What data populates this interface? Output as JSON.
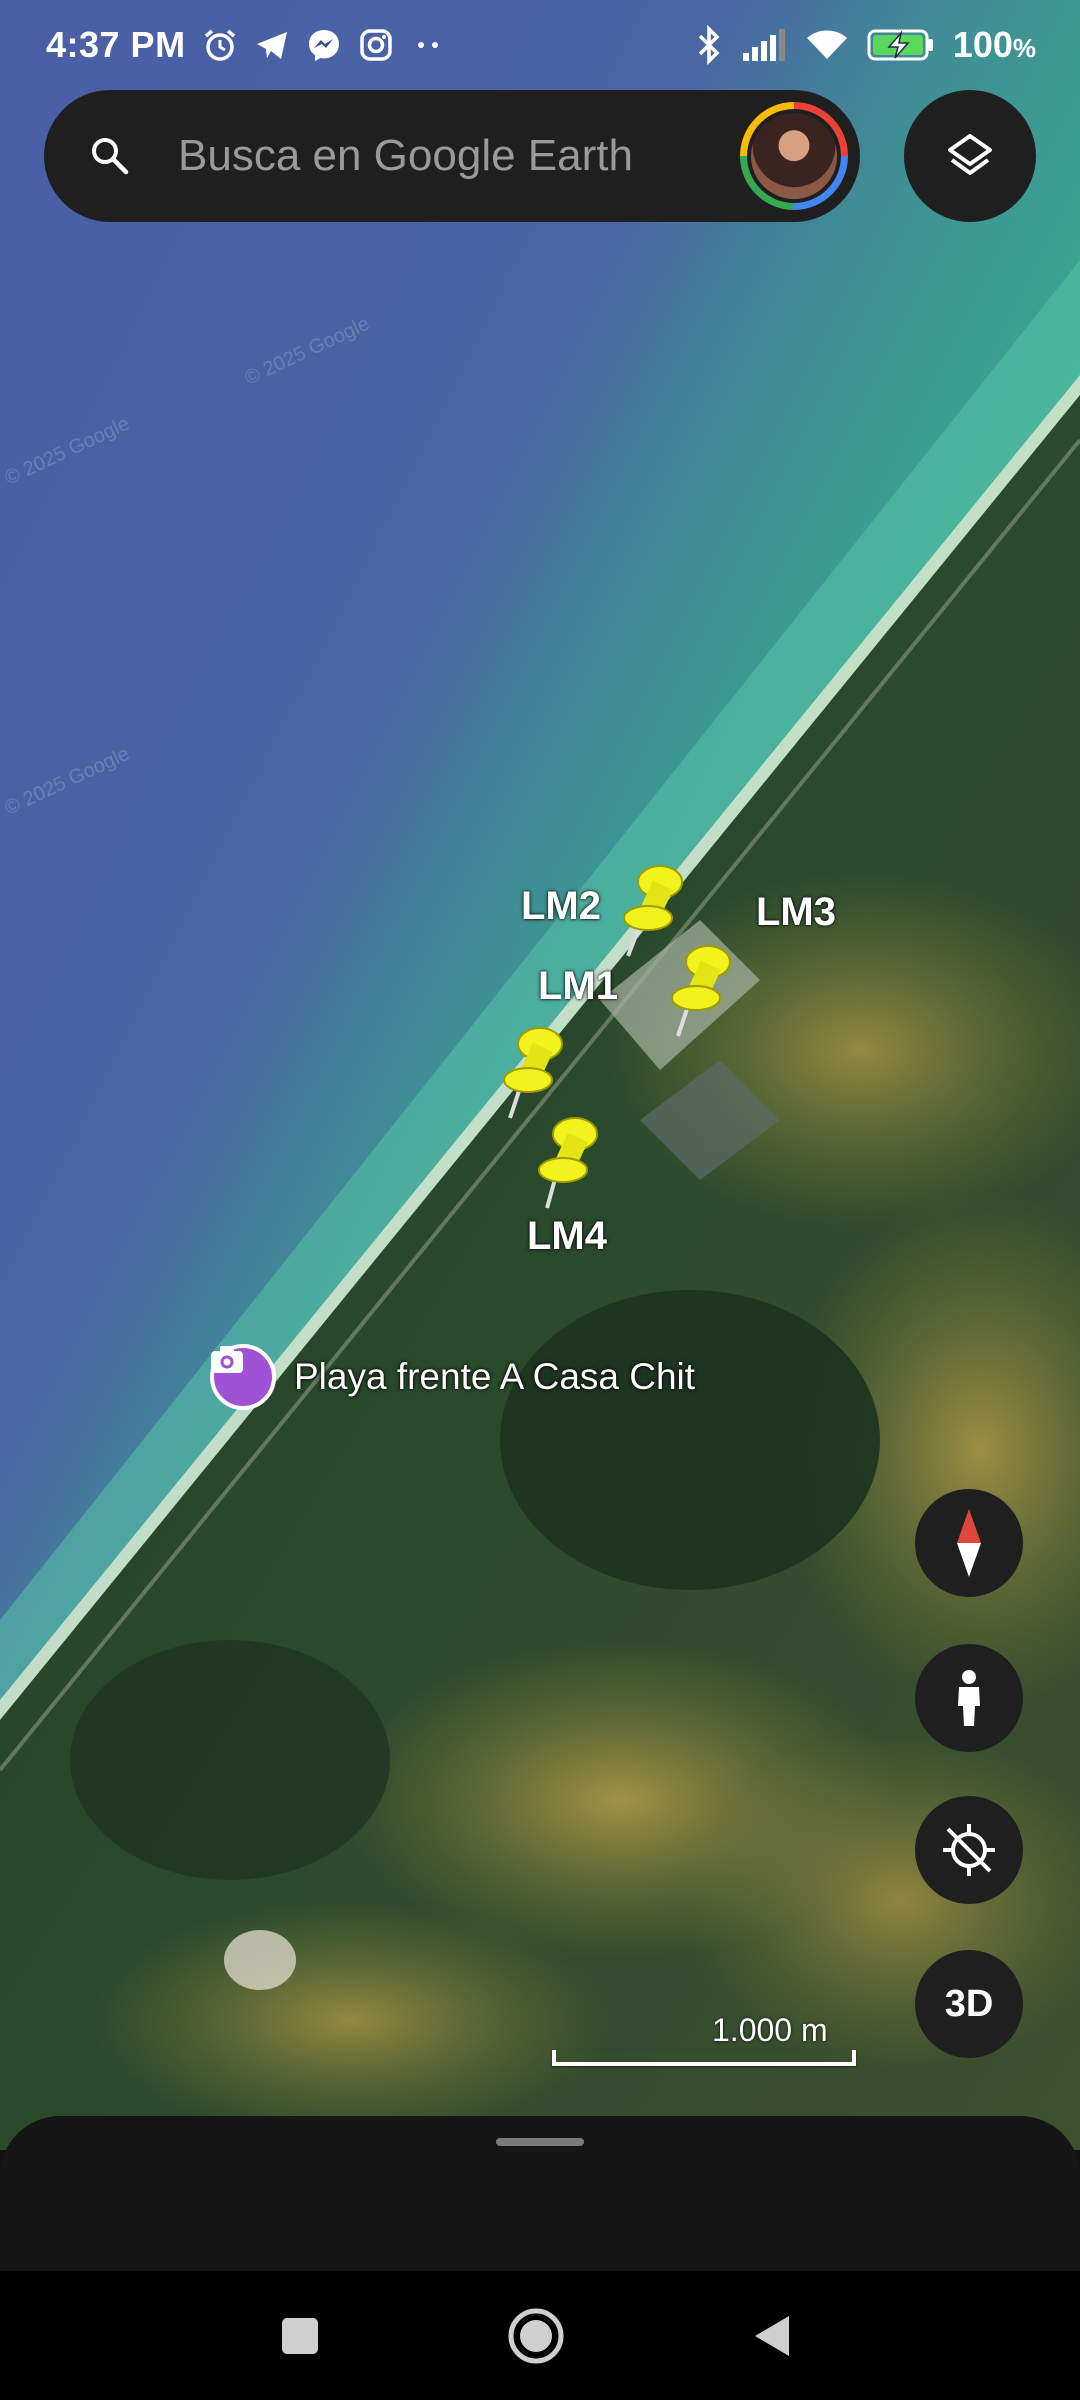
{
  "status_bar": {
    "time": "4:37 PM",
    "left_icons": [
      "alarm-icon",
      "telegram-icon",
      "messenger-icon",
      "instagram-icon",
      "more-dots-icon"
    ],
    "right_icons": [
      "bluetooth-icon",
      "signal-icon",
      "wifi-icon",
      "battery-charging-icon"
    ],
    "battery_text": "100",
    "battery_unit": "%"
  },
  "search": {
    "placeholder": "Busca en Google Earth",
    "icon": "search-icon"
  },
  "layers_button": {
    "icon": "layers-icon"
  },
  "map": {
    "watermark": "© 2025 Google",
    "placemarks": [
      {
        "label": "LM2",
        "icon": "yellow-pushpin-icon"
      },
      {
        "label": "LM3",
        "icon": "yellow-pushpin-icon"
      },
      {
        "label": "LM1",
        "icon": "yellow-pushpin-icon"
      },
      {
        "label": "LM4",
        "icon": "yellow-pushpin-icon"
      }
    ],
    "poi": {
      "label": "Playa frente A Casa Chit",
      "icon": "photo-camera-icon",
      "color": "#a052d6"
    },
    "scale_label": "1.000 m"
  },
  "controls": {
    "compass": "compass-icon",
    "street_view": "pegman-icon",
    "my_location": "location-disabled-icon",
    "view_3d": "3D"
  },
  "nav_bar": [
    "recents-square-icon",
    "home-circle-icon",
    "back-triangle-icon"
  ]
}
